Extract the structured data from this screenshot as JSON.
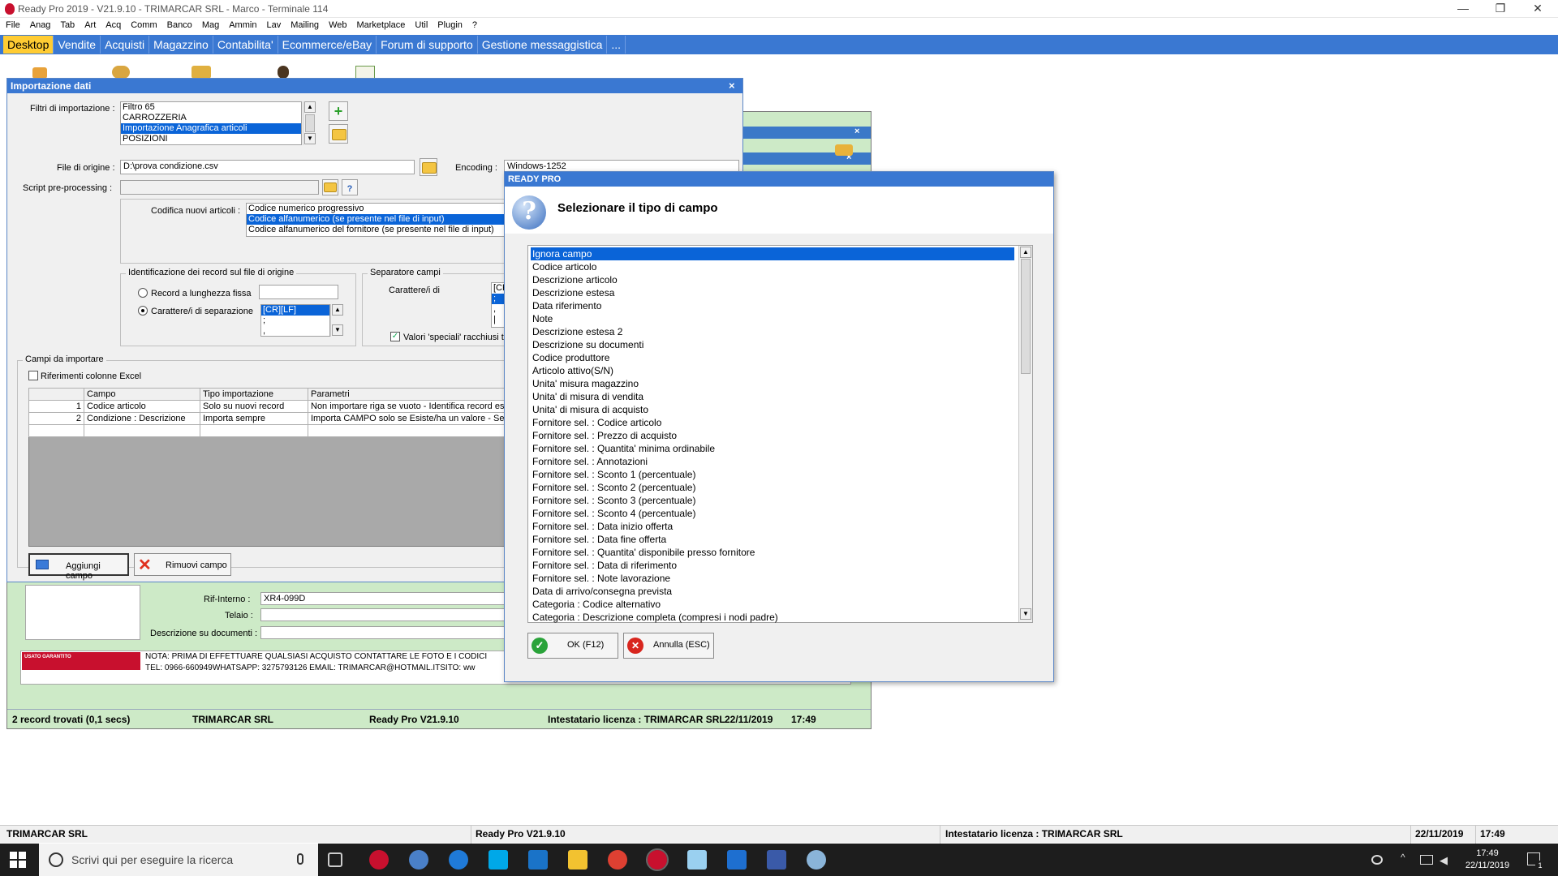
{
  "window": {
    "title": "Ready Pro 2019 - V21.9.10 - TRIMARCAR SRL - Marco - Terminale 114",
    "minimize": "—",
    "restore": "❐",
    "close": "✕"
  },
  "menubar": [
    "File",
    "Anag",
    "Tab",
    "Art",
    "Acq",
    "Comm",
    "Banco",
    "Mag",
    "Ammin",
    "Lav",
    "Mailing",
    "Web",
    "Marketplace",
    "Util",
    "Plugin",
    "?"
  ],
  "tabs": [
    {
      "label": "Desktop",
      "active": true
    },
    {
      "label": "Vendite"
    },
    {
      "label": "Acquisti"
    },
    {
      "label": "Magazzino"
    },
    {
      "label": "Contabilita'"
    },
    {
      "label": "Ecommerce/eBay"
    },
    {
      "label": "Forum di supporto"
    },
    {
      "label": "Gestione messaggistica"
    },
    {
      "label": "..."
    }
  ],
  "background_window": {
    "rif_interno_label": "Rif-Interno :",
    "rif_interno_value": "XR4-099D",
    "telaio_label": "Telaio :",
    "descr_label": "Descrizione su documenti :",
    "banner_text": "USATO GARANTITO",
    "note_line1": "NOTA: PRIMA DI EFFETTUARE QUALSIASI ACQUISTO CONTATTARE LE FOTO E I CODICI",
    "note_line2": "TEL: 0966-660949WHATSAPP: 3275793126     EMAIL: TRIMARCAR@HOTMAIL.ITSITO:  ww",
    "status": {
      "records": "2 record trovati (0,1 secs)",
      "company": "TRIMARCAR SRL",
      "version": "Ready Pro V21.9.10",
      "license": "Intestatario licenza : TRIMARCAR SRL",
      "date": "22/11/2019",
      "time": "17:49"
    }
  },
  "import_dialog": {
    "title": "Importazione dati",
    "close": "×",
    "filters_label": "Filtri di importazione :",
    "filters": [
      "Filtro 65",
      "CARROZZERIA",
      "Importazione Anagrafica articoli",
      "POSIZIONI"
    ],
    "filters_selected": 2,
    "source_file_label": "File di origine :",
    "source_file_value": "D:\\prova condizione.csv",
    "encoding_label": "Encoding :",
    "encoding_value": "Windows-1252",
    "script_label": "Script pre-processing :",
    "coding_label": "Codifica nuovi articoli :",
    "coding_options": [
      "Codice numerico progressivo",
      "Codice alfanumerico (se presente nel file di input)",
      "Codice alfanumerico del fornitore (se presente nel file di input)"
    ],
    "coding_selected": 1,
    "ident_group": "Identificazione dei record sul file di origine",
    "radio_fixed": "Record a lunghezza fissa",
    "radio_sep": "Carattere/i di separazione",
    "sep_list": [
      "[CR][LF]",
      ";",
      ","
    ],
    "sep_fields_group": "Separatore campi",
    "sep_fields_label": "Carattere/i di",
    "sep_fields_list": [
      "[CR",
      ";",
      ",",
      "|"
    ],
    "special_values_label": "Valori 'speciali' racchiusi tra",
    "fields_group": "Campi da importare",
    "excel_refs_label": "Riferimenti colonne Excel",
    "grid_headers": [
      "",
      "Campo",
      "Tipo importazione",
      "Parametri"
    ],
    "grid_rows": [
      [
        "1",
        "Codice articolo",
        "Solo su nuovi record",
        "Non importare riga se vuoto - Identifica record esis"
      ],
      [
        "2",
        "Condizione : Descrizione",
        "Importa sempre",
        "Importa CAMPO solo se Esiste/ha un valore  - Se il"
      ]
    ],
    "add_field": "Aggiungi campo",
    "remove_field": "Rimuovi campo"
  },
  "select_dialog": {
    "title": "READY PRO",
    "question_icon": "?",
    "heading": "Selezionare il tipo di campo",
    "items": [
      "Ignora campo",
      "Codice articolo",
      "Descrizione articolo",
      "Descrizione estesa",
      "Data riferimento",
      "Note",
      "Descrizione estesa 2",
      "Descrizione su documenti",
      "Codice produttore",
      "Articolo attivo(S/N)",
      "Unita' misura magazzino",
      "Unita' di misura di vendita",
      "Unita' di misura di acquisto",
      "Fornitore sel. : Codice articolo",
      "Fornitore sel. : Prezzo di acquisto",
      "Fornitore sel. : Quantita' minima ordinabile",
      "Fornitore sel. : Annotazioni",
      "Fornitore sel. : Sconto 1 (percentuale)",
      "Fornitore sel. : Sconto 2 (percentuale)",
      "Fornitore sel. : Sconto 3 (percentuale)",
      "Fornitore sel. : Sconto 4 (percentuale)",
      "Fornitore sel. : Data inizio offerta",
      "Fornitore sel. : Data fine offerta",
      "Fornitore sel. : Quantita' disponibile presso fornitore",
      "Fornitore sel. : Data di riferimento",
      "Fornitore sel. : Note lavorazione",
      "Data di arrivo/consegna prevista",
      "Categoria : Codice alternativo",
      "Categoria : Descrizione completa (compresi i nodi padre)"
    ],
    "selected_index": 0,
    "ok_label": "OK (F12)",
    "cancel_label": "Annulla (ESC)"
  },
  "statusbar": {
    "company": "TRIMARCAR SRL",
    "version": "Ready Pro V21.9.10",
    "license": "Intestatario licenza : TRIMARCAR SRL",
    "date": "22/11/2019",
    "time": "17:49"
  },
  "taskbar": {
    "search_placeholder": "Scrivi qui per eseguire la ricerca",
    "clock_time": "17:49",
    "clock_date": "22/11/2019",
    "notifications": "1"
  },
  "colors": {
    "tabbar": "#3a78d2",
    "active_tab": "#ffcc33",
    "selection": "#0a64d8",
    "bg_window": "#cdeac7"
  }
}
